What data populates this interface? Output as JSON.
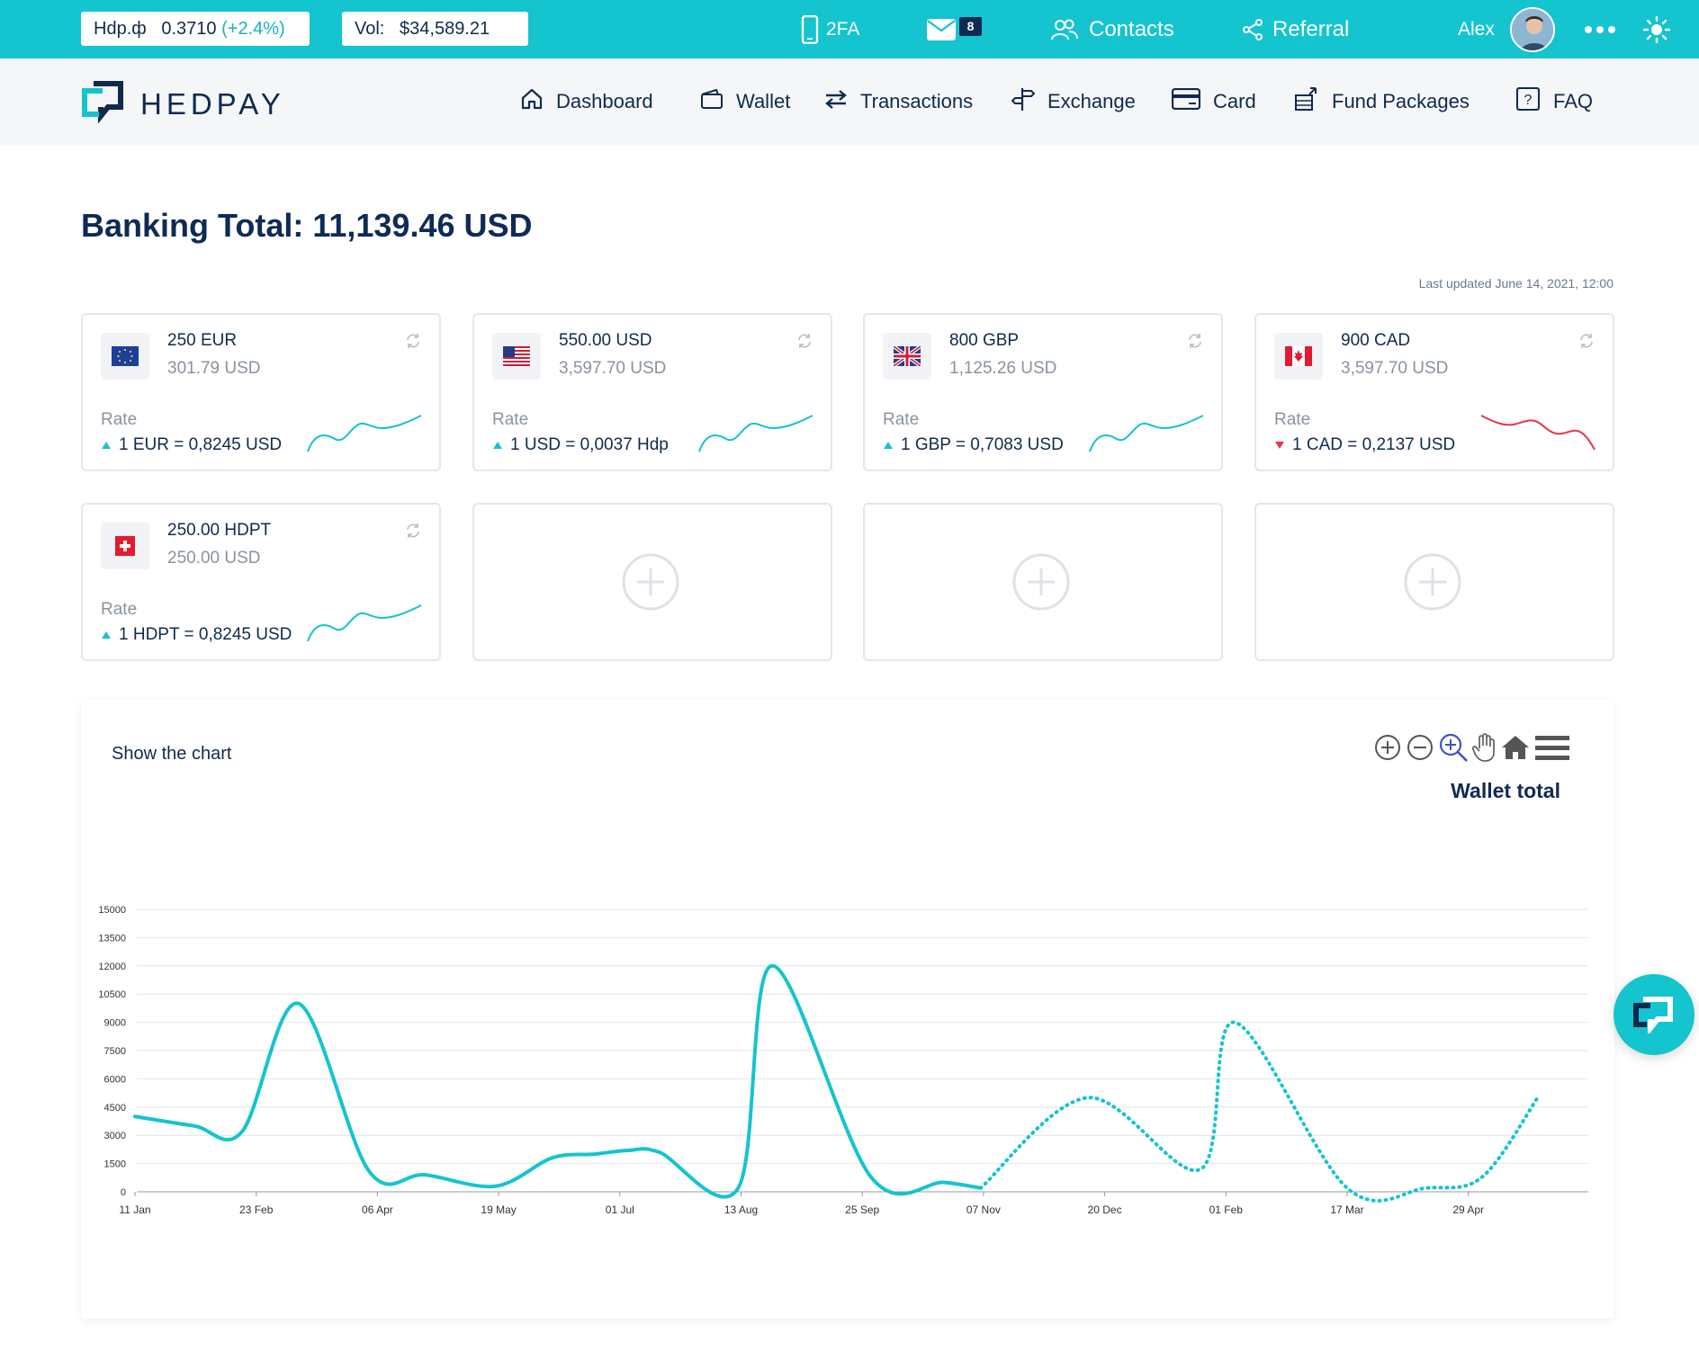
{
  "topbar": {
    "ticker_label": "Hdp.ф",
    "ticker_price": "0.3710",
    "ticker_change": "(+2.4%)",
    "volume_label": "Vol:",
    "volume_value": "$34,589.21",
    "twofa": "2FA",
    "messages_count": "8",
    "contacts": "Contacts",
    "referral": "Referral",
    "username": "Alex"
  },
  "brand": {
    "name": "HEDPAY"
  },
  "nav": [
    {
      "label": "Dashboard",
      "icon": "home-icon"
    },
    {
      "label": "Wallet",
      "icon": "wallet-icon"
    },
    {
      "label": "Transactions",
      "icon": "transfer-arrows-icon"
    },
    {
      "label": "Exchange",
      "icon": "signpost-icon"
    },
    {
      "label": "Card",
      "icon": "credit-card-icon"
    },
    {
      "label": "Fund Packages",
      "icon": "packages-icon"
    },
    {
      "label": "FAQ",
      "icon": "question-icon"
    }
  ],
  "summary": {
    "banking_total": "Banking Total:  11,139.46 USD",
    "last_updated": "Last updated June 14, 2021, 12:00"
  },
  "currency_cards": [
    {
      "amount": "250 EUR",
      "usd": "301.79 USD",
      "rate_label": "Rate",
      "rate": "1 EUR = 0,8245 USD",
      "trend": "up",
      "flag": "eu-flag-icon"
    },
    {
      "amount": "550.00 USD",
      "usd": "3,597.70 USD",
      "rate_label": "Rate",
      "rate": "1 USD = 0,0037 Hdp",
      "trend": "up",
      "flag": "us-flag-icon"
    },
    {
      "amount": "800 GBP",
      "usd": "1,125.26 USD",
      "rate_label": "Rate",
      "rate": "1 GBP = 0,7083 USD",
      "trend": "up",
      "flag": "uk-flag-icon"
    },
    {
      "amount": "900 CAD",
      "usd": "3,597.70 USD",
      "rate_label": "Rate",
      "rate": "1 CAD = 0,2137 USD",
      "trend": "down",
      "flag": "canada-flag-icon"
    },
    {
      "amount": "250.00 HDPT",
      "usd": "250.00 USD",
      "rate_label": "Rate",
      "rate": "1 HDPT = 0,8245 USD",
      "trend": "up",
      "flag": "swiss-flag-icon"
    }
  ],
  "chart_panel": {
    "toggle_label": "Show the chart",
    "title": "Wallet total"
  },
  "colors": {
    "accent": "#14c4cf",
    "navy": "#102a4c",
    "down": "#e8334a"
  },
  "chart_data": {
    "type": "line",
    "title": "Wallet total",
    "xlabel": "",
    "ylabel": "",
    "ylim": [
      0,
      15000
    ],
    "yticks": [
      0,
      1500,
      3000,
      4500,
      6000,
      7500,
      9000,
      10500,
      12000,
      13500,
      15000
    ],
    "x_tick_labels": [
      "11 Jan",
      "23 Feb",
      "06 Apr",
      "19 May",
      "01 Jul",
      "13 Aug",
      "25 Sep",
      "07 Nov",
      "20 Dec",
      "01 Feb",
      "17 Mar",
      "29 Apr"
    ],
    "series": [
      {
        "style": "solid",
        "x": [
          "11 Jan",
          "01 Feb",
          "18 Feb",
          "10 Mar",
          "04 Apr",
          "24 Apr",
          "19 May",
          "08 Jun",
          "23 Jun",
          "05 Jul",
          "16 Jul",
          "13 Aug",
          "25 Aug",
          "29 Sep",
          "25 Oct",
          "07 Nov"
        ],
        "values": [
          4000,
          3500,
          3200,
          10000,
          1100,
          900,
          300,
          1800,
          2000,
          2200,
          2100,
          200,
          12000,
          800,
          500,
          200
        ]
      },
      {
        "style": "dotted",
        "x": [
          "07 Nov",
          "15 Dec",
          "24 Jan",
          "05 Feb",
          "17 Mar",
          "14 Apr",
          "04 May",
          "24 May"
        ],
        "values": [
          200,
          5000,
          1200,
          9000,
          200,
          200,
          800,
          5100
        ]
      }
    ]
  }
}
